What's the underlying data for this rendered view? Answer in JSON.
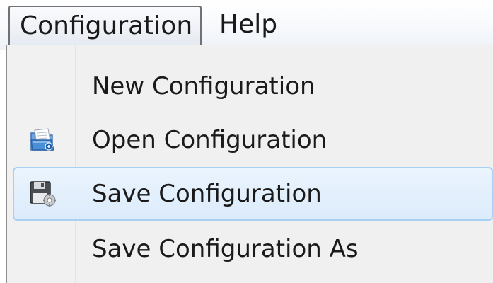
{
  "menubar": {
    "items": [
      {
        "label": "Configuration",
        "state": "open"
      },
      {
        "label": "Help"
      }
    ]
  },
  "dropdown": {
    "items": [
      {
        "label": "New Configuration",
        "icon": null
      },
      {
        "label": "Open Configuration",
        "icon": "open-folder-icon"
      },
      {
        "label": "Save Configuration",
        "icon": "save-disk-icon",
        "state": "hover"
      },
      {
        "label": "Save Configuration As",
        "icon": null
      }
    ]
  },
  "colors": {
    "menu_background": "#f0f0f0",
    "hover_fill": "#dcebfc",
    "hover_border": "#a8d0f2",
    "open_menu_border": "#6f7276"
  }
}
